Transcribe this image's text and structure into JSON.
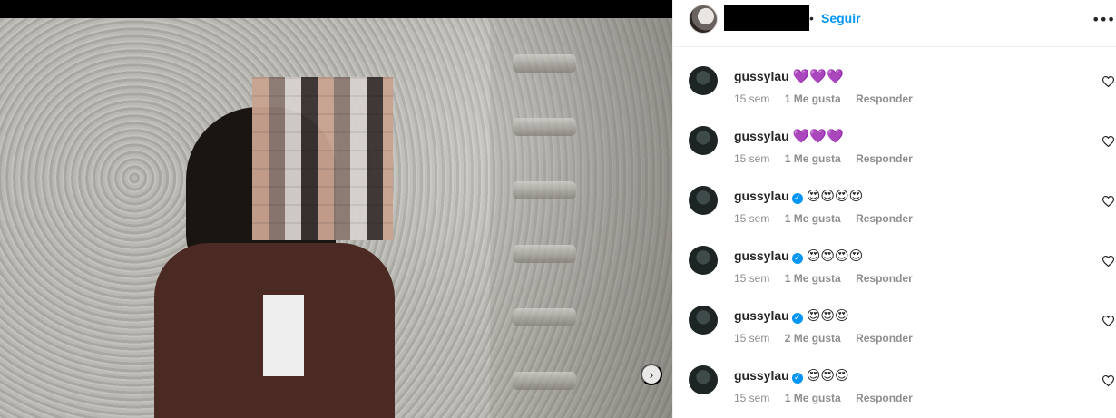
{
  "post": {
    "follow_label": "Seguir",
    "separator": "•",
    "more_label": "•••",
    "carousel_next": "›"
  },
  "comments": [
    {
      "user": "gussylau",
      "verified": false,
      "text": "💜💜💜",
      "time": "15 sem",
      "likes": "1 Me gusta",
      "reply": "Responder"
    },
    {
      "user": "gussylau",
      "verified": false,
      "text": "💜💜💜",
      "time": "15 sem",
      "likes": "1 Me gusta",
      "reply": "Responder"
    },
    {
      "user": "gussylau",
      "verified": true,
      "verified_mark": "✓",
      "text": "😍😍😍😍",
      "time": "15 sem",
      "likes": "1 Me gusta",
      "reply": "Responder"
    },
    {
      "user": "gussylau",
      "verified": true,
      "verified_mark": "✓",
      "text": "😍😍😍😍",
      "time": "15 sem",
      "likes": "1 Me gusta",
      "reply": "Responder"
    },
    {
      "user": "gussylau",
      "verified": true,
      "verified_mark": "✓",
      "text": "😍😍😍",
      "time": "15 sem",
      "likes": "2 Me gusta",
      "reply": "Responder"
    },
    {
      "user": "gussylau",
      "verified": true,
      "verified_mark": "✓",
      "text": "😍😍😍",
      "time": "15 sem",
      "likes": "1 Me gusta",
      "reply": "Responder"
    }
  ],
  "icons": {
    "heart": "heart-icon",
    "verified": "verified-badge-icon",
    "more": "more-options-icon"
  },
  "colors": {
    "accent": "#0095f6",
    "meta": "#8e8e8e",
    "text": "#262626"
  }
}
